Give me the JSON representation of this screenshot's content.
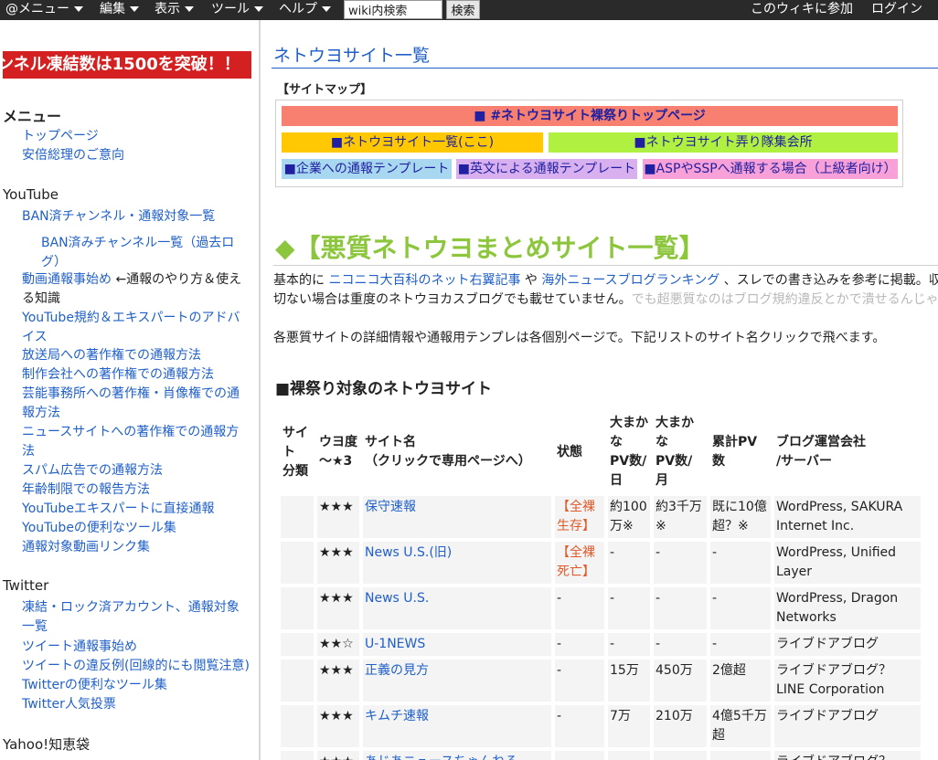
{
  "topbar": {
    "menu": "@メニュー",
    "edit": "編集",
    "view": "表示",
    "tool": "ツール",
    "help": "ヘルプ",
    "search_value": "wiki内検索",
    "search_button": "検索",
    "join": "このウィキに参加",
    "login": "ログイン"
  },
  "sidebar": {
    "banner": "ンネル凍結数は1500を突破！！",
    "menu_heading": "メニュー",
    "menu_items": [
      "トップページ",
      "安倍総理のご意向"
    ],
    "youtube_heading": "YouTube",
    "youtube_items": {
      "ban_list": "BAN済チャンネル・通報対象一覧",
      "ban_past_1": "BAN済みチャンネル一覧（過去ロ",
      "ban_past_2": "グ）",
      "report_start_1": "動画通報事始め",
      "report_start_note_1": "←通報のやり方＆使え",
      "report_start_2": "る知識",
      "guidelines_1": "YouTube規約＆エキスパートのアドバ",
      "guidelines_2": "イス",
      "broadcaster": "放送局への著作権での通報方法",
      "production": "制作会社への著作権での通報方法",
      "agency_1": "芸能事務所への著作権・肖像権での通",
      "agency_2": "報方法",
      "news_1": "ニュースサイトへの著作権での通報方",
      "news_2": "法",
      "spam": "スパム広告での通報方法",
      "age": "年齢制限での報告方法",
      "expert": "YouTubeエキスパートに直接通報",
      "tools": "YouTubeの便利なツール集",
      "links": "通報対象動画リンク集"
    },
    "twitter_heading": "Twitter",
    "twitter_items": {
      "frozen_1": "凍結・ロック済アカウント、通報対象",
      "frozen_2": "一覧",
      "tweet_start": "ツイート通報事始め",
      "violations": "ツイートの違反例(回線的にも閲覧注意)",
      "tools": "Twitterの便利なツール集",
      "poll": "Twitter人気投票"
    },
    "yahoo_heading": "Yahoo!知恵袋"
  },
  "main": {
    "page_title": "ネトウヨサイト一覧",
    "sitemap_label": "【サイトマップ】",
    "sitemap": {
      "top": "■ #ネトウヨサイト裸祭りトップページ",
      "list": "■ネトウヨサイト一覧(ここ)",
      "squad": "■ネトウヨサイト弄り隊集会所",
      "corp": "■企業への通報テンプレート",
      "english": "■英文による通報テンプレート",
      "asp": "■ASPやSSPへ通報する場合（上級者向け）"
    },
    "colors": {
      "top": "#f88070",
      "list": "#ffc800",
      "squad": "#b0f040",
      "corp": "#a8d8f0",
      "english": "#d8b0f0",
      "asp": "#f8a0d8",
      "big_title": "#8cc63c",
      "banner": "#d42020"
    },
    "big_title": "◆【悪質ネトウヨまとめサイト一覧】",
    "para1": {
      "a": "基本的に",
      "link1": "ニコニコ大百科のネット右翼記事",
      "b": "や",
      "link2": "海外ニュースブログランキング",
      "c": "、スレでの書き込みを参考に掲載。収"
    },
    "para2": {
      "a": "切ない場合は重度のネトウヨカスブログでも載せていません。",
      "gray": "でも超悪質なのはブログ規約違反とかで潰せるんじゃ"
    },
    "para3": "各悪質サイトの詳細情報や通報用テンプレは各個別ページで。下記リストのサイト名クリックで飛べます。",
    "section_title": "■裸祭り対象のネトウヨサイト",
    "table": {
      "headers": {
        "cat_1": "サイ",
        "cat_2": "ト",
        "cat_3": "分類",
        "deg_1": "ウヨ度",
        "deg_2": "～★3",
        "name_1": "サイト名",
        "name_2": "（クリックで専用ページへ）",
        "status": "状態",
        "daypv_1": "大まか",
        "daypv_2": "な",
        "daypv_3": "PV数/",
        "daypv_4": "日",
        "monthpv_1": "大まかな",
        "monthpv_2": "PV数/月",
        "totalpv": "累計PV数",
        "company_1": "ブログ運営会社",
        "company_2": "/サーバー"
      },
      "rows": [
        {
          "deg": "★★★",
          "name": "保守速報",
          "status_1": "【全裸",
          "status_2": "生存】",
          "daypv_1": "約100",
          "daypv_2": "万※",
          "monthpv_1": "約3千万",
          "monthpv_2": "※",
          "totalpv_1": "既に10億",
          "totalpv_2": "超？※",
          "company_1": "WordPress, SAKURA",
          "company_2": "Internet Inc."
        },
        {
          "deg": "★★★",
          "name": "News U.S.(旧)",
          "status_1": "【全裸",
          "status_2": "死亡】",
          "daypv_1": "-",
          "daypv_2": "",
          "monthpv_1": "-",
          "monthpv_2": "",
          "totalpv_1": "-",
          "totalpv_2": "",
          "company_1": "WordPress, Unified",
          "company_2": "Layer"
        },
        {
          "deg": "★★★",
          "name": "News U.S.",
          "status_1": "-",
          "status_2": "",
          "daypv_1": "-",
          "daypv_2": "",
          "monthpv_1": "-",
          "monthpv_2": "",
          "totalpv_1": "-",
          "totalpv_2": "",
          "company_1": "WordPress, Dragon",
          "company_2": "Networks"
        },
        {
          "deg": "★★☆",
          "name": "U-1NEWS",
          "status_1": "-",
          "status_2": "",
          "daypv_1": "-",
          "daypv_2": "",
          "monthpv_1": "-",
          "monthpv_2": "",
          "totalpv_1": "-",
          "totalpv_2": "",
          "company_1": "ライブドアブログ",
          "company_2": ""
        },
        {
          "deg": "★★★",
          "name": "正義の見方",
          "status_1": "-",
          "status_2": "",
          "daypv_1": "15万",
          "daypv_2": "",
          "monthpv_1": "450万",
          "monthpv_2": "",
          "totalpv_1": "2億超",
          "totalpv_2": "",
          "company_1": "ライブドアブログ？",
          "company_2": "LINE Corporation"
        },
        {
          "deg": "★★★",
          "name": "キムチ速報",
          "status_1": "-",
          "status_2": "",
          "daypv_1": "7万",
          "daypv_2": "",
          "monthpv_1": "210万",
          "monthpv_2": "",
          "totalpv_1": "4億5千万",
          "totalpv_2": "超",
          "company_1": "ライブドアブログ",
          "company_2": ""
        },
        {
          "deg": "★★★",
          "name": "あじあニュースちゃんねる",
          "status_1": "-",
          "status_2": "",
          "daypv_1": "-",
          "daypv_2": "",
          "monthpv_1": "-",
          "monthpv_2": "",
          "totalpv_1": "-",
          "totalpv_2": "",
          "company_1": "ライブドアブログ？",
          "company_2": ""
        }
      ]
    }
  }
}
